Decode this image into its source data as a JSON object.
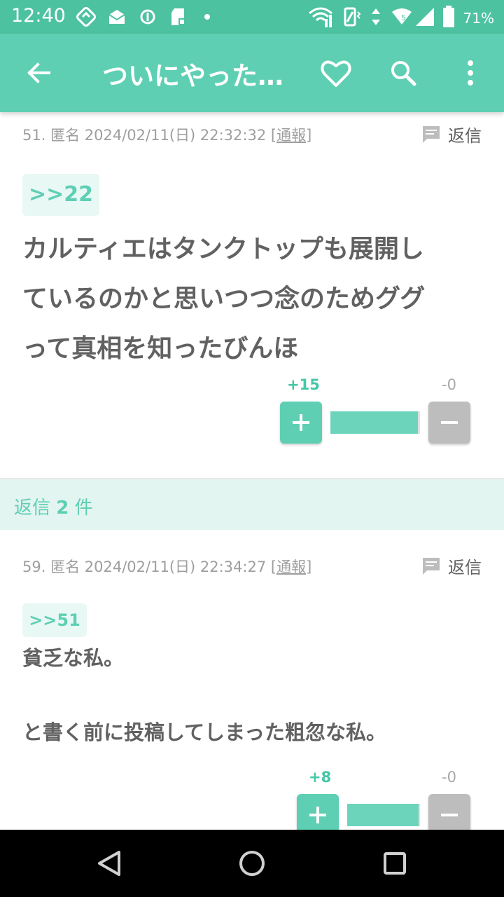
{
  "status_bar": {
    "time": "12:40",
    "battery": "71%",
    "icons_left": [
      "sync-icon",
      "mail-icon",
      "info-icon",
      "sd-card-icon",
      "dot-icon"
    ],
    "icons_right": [
      "wifi-icon",
      "vibrate-icon",
      "data-icon",
      "signal-icon",
      "battery-icon"
    ]
  },
  "app_bar": {
    "title": "ついにやった…",
    "actions": [
      "back-icon",
      "heart-icon",
      "search-icon",
      "more-icon"
    ],
    "color": "#5fcfb3"
  },
  "posts": [
    {
      "number": "51.",
      "author": "匿名",
      "datetime": "2024/02/11(日) 22:32:32",
      "report": "[通報]",
      "reply_label": "返信",
      "anchor": ">>22",
      "body_lines": [
        "カルティエはタンクトップも展開し",
        "ているのかと思いつつ念のためググ",
        "って真相を知ったびんほ"
      ],
      "votes_plus": "+15",
      "votes_minus": "-0",
      "plus_ratio": 0.98
    },
    {
      "number": "59.",
      "author": "匿名",
      "datetime": "2024/02/11(日) 22:34:27",
      "report": "[通報]",
      "reply_label": "返信",
      "anchor": ">>51",
      "body_lines": [
        "貧乏な私。",
        "",
        "と書く前に投稿してしまった粗忽な私。"
      ],
      "votes_plus": "+8",
      "votes_minus": "-0",
      "plus_ratio": 0.98
    }
  ],
  "replies_band": {
    "prefix": "返信",
    "count": "2",
    "suffix": "件"
  },
  "nav_bar": [
    "back-nav-icon",
    "home-nav-icon",
    "recents-nav-icon"
  ]
}
